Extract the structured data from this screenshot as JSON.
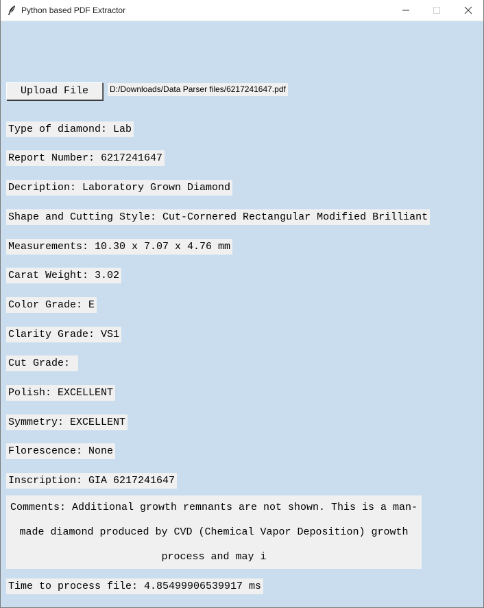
{
  "window": {
    "title": "Python based PDF Extractor",
    "icon": "feather-icon"
  },
  "upload": {
    "button_label": "Upload File",
    "file_path": "D:/Downloads/Data Parser files/6217241647.pdf"
  },
  "fields": {
    "type_of_diamond": "Type of diamond: Lab",
    "report_number": "Report Number: 6217241647",
    "description": "Decription: Laboratory Grown Diamond",
    "shape_cutting_style": "Shape and Cutting Style: Cut-Cornered Rectangular Modified Brilliant",
    "measurements": "Measurements: 10.30 x 7.07 x 4.76 mm",
    "carat_weight": "Carat Weight: 3.02",
    "color_grade": "Color Grade: E",
    "clarity_grade": "Clarity Grade: VS1",
    "cut_grade": "Cut Grade: ",
    "polish": "Polish: EXCELLENT",
    "symmetry": "Symmetry: EXCELLENT",
    "florescence": "Florescence: None",
    "inscription": "Inscription: GIA 6217241647",
    "comments": "Comments: Additional growth remnants are not shown. This is a man-made diamond produced by CVD (Chemical Vapor Deposition) growth process and may i",
    "process_time": "Time to process file: 4.85499906539917 ms"
  },
  "colors": {
    "window_background": "#c9ddef",
    "label_background": "#f0f0f0"
  }
}
